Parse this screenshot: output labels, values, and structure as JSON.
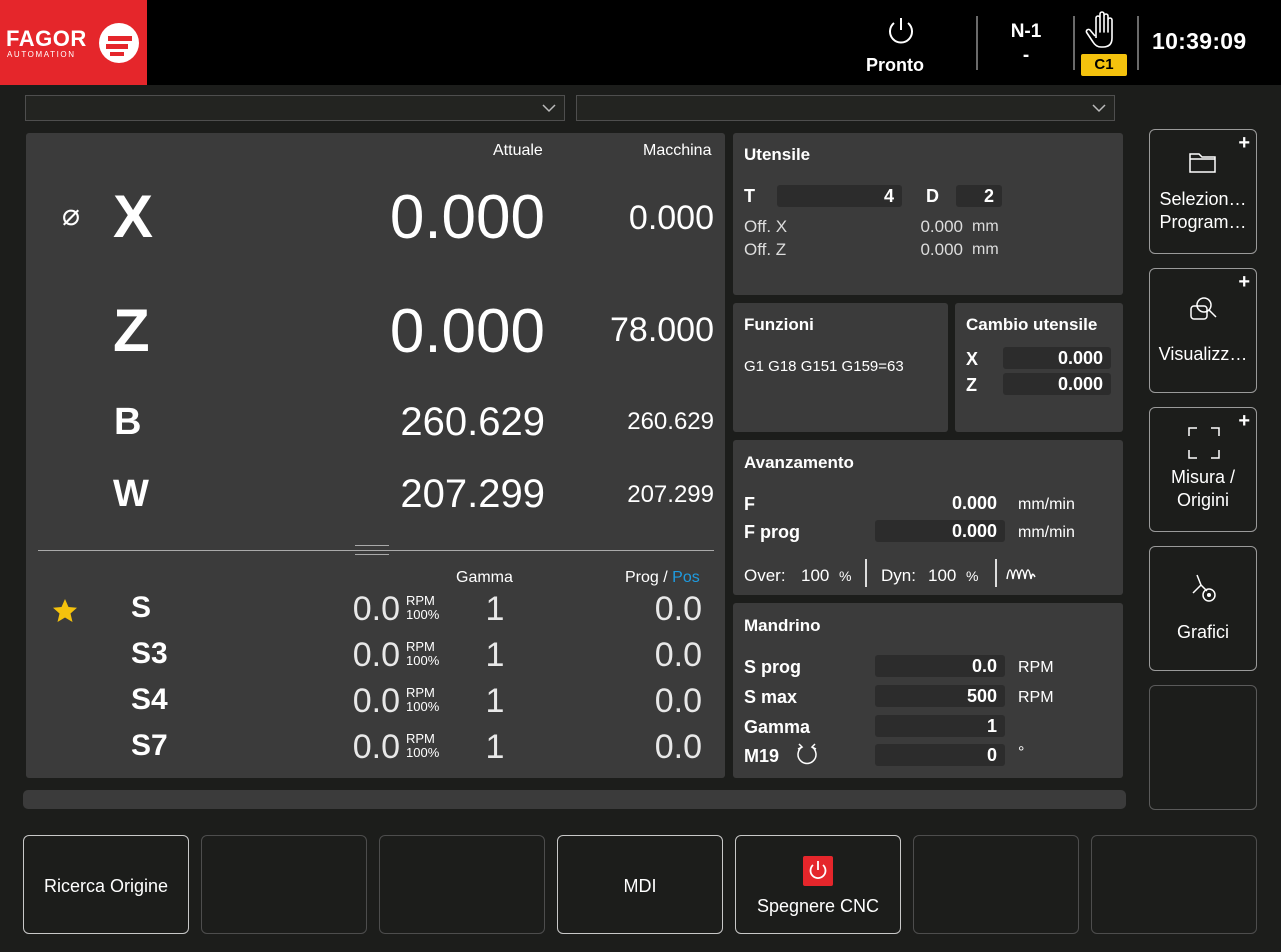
{
  "header": {
    "brand": "FAGOR",
    "brand_sub": "AUTOMATION",
    "status": "Pronto",
    "block_line1": "N-1",
    "block_line2": "-",
    "channel": "C1",
    "time": "10:39:09"
  },
  "axes": {
    "col_actual": "Attuale",
    "col_machine": "Macchina",
    "diameter_symbol": "⌀",
    "rows": [
      {
        "name": "X",
        "actual": "0.000",
        "machine": "0.000"
      },
      {
        "name": "Z",
        "actual": "0.000",
        "machine": "78.000"
      },
      {
        "name": "B",
        "actual": "260.629",
        "machine": "260.629"
      },
      {
        "name": "W",
        "actual": "207.299",
        "machine": "207.299"
      }
    ]
  },
  "spindles": {
    "col_range": "Gamma",
    "col_prog": "Prog /",
    "col_pos": "Pos",
    "rpm_unit": "RPM",
    "pct": "100%",
    "rows": [
      {
        "name": "S",
        "value": "0.0",
        "range": "1",
        "prog": "0.0"
      },
      {
        "name": "S3",
        "value": "0.0",
        "range": "1",
        "prog": "0.0"
      },
      {
        "name": "S4",
        "value": "0.0",
        "range": "1",
        "prog": "0.0"
      },
      {
        "name": "S7",
        "value": "0.0",
        "range": "1",
        "prog": "0.0"
      }
    ]
  },
  "tool": {
    "title": "Utensile",
    "t_label": "T",
    "t_value": "4",
    "d_label": "D",
    "d_value": "2",
    "offx_label": "Off. X",
    "offx_value": "0.000",
    "offz_label": "Off. Z",
    "offz_value": "0.000",
    "unit": "mm"
  },
  "functions": {
    "title": "Funzioni",
    "text": "G1 G18 G151 G159=63"
  },
  "tool_change": {
    "title": "Cambio utensile",
    "x_label": "X",
    "x_value": "0.000",
    "z_label": "Z",
    "z_value": "0.000"
  },
  "feed": {
    "title": "Avanzamento",
    "f_label": "F",
    "f_value": "0.000",
    "fprog_label": "F prog",
    "fprog_value": "0.000",
    "unit": "mm/min",
    "over_label": "Over:",
    "over_value": "100",
    "dyn_label": "Dyn:",
    "dyn_value": "100",
    "pct": "%"
  },
  "spindle_panel": {
    "title": "Mandrino",
    "sprog_label": "S prog",
    "sprog_value": "0.0",
    "smax_label": "S max",
    "smax_value": "500",
    "gamma_label": "Gamma",
    "gamma_value": "1",
    "m19_label": "M19",
    "m19_value": "0",
    "rpm": "RPM",
    "deg": "°"
  },
  "side_buttons": {
    "plus": "+",
    "select_l1": "Selezion…",
    "select_l2": "Program…",
    "view": "Visualizz…",
    "measure_l1": "Misura /",
    "measure_l2": "Origini",
    "graphics": "Grafici"
  },
  "bottom_buttons": {
    "home_search": "Ricerca Origine",
    "mdi": "MDI",
    "shutdown": "Spegnere CNC"
  },
  "colors": {
    "brand_red": "#e5262b",
    "accent_blue": "#1e9be0",
    "badge_yellow": "#f4c20d",
    "panel": "#3b3b3b"
  }
}
